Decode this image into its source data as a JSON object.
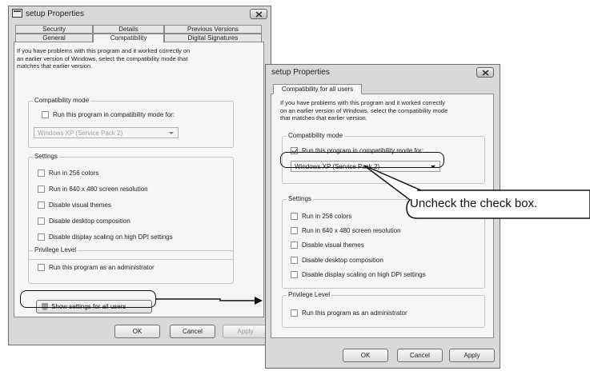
{
  "left_window": {
    "title": "setup Properties",
    "tabs_row1": [
      "Security",
      "Details",
      "Previous Versions"
    ],
    "tabs_row2": [
      "General",
      "Compatibility",
      "Digital Signatures"
    ],
    "description": [
      "If you have problems with this program and it worked correctly on",
      "an earlier version of Windows, select the compatibility mode that",
      "matches that earlier version."
    ],
    "compat_group": {
      "title": "Compatibility mode",
      "checkbox": "Run this program in compatibility mode for:",
      "select_value": "Windows XP (Service Pack 2)"
    },
    "settings_group": {
      "title": "Settings",
      "items": [
        "Run in 256 colors",
        "Run in 640 x 480 screen resolution",
        "Disable visual themes",
        "Disable desktop composition",
        "Disable display scaling on high DPI settings"
      ]
    },
    "privilege_group": {
      "title": "Privilege Level",
      "checkbox": "Run this program as an administrator"
    },
    "show_settings_button": "Show settings for all users",
    "buttons": {
      "ok": "OK",
      "cancel": "Cancel",
      "apply": "Apply"
    }
  },
  "right_window": {
    "title": "setup Properties",
    "tab": "Compatibility for all users",
    "description": [
      "If you have problems with this program and it worked correctly",
      "on an earlier version of Windows, select the compatibility mode",
      "that matches that earlier version."
    ],
    "compat_group": {
      "title": "Compatibility mode",
      "checkbox": "Run this program in compatibility mode for:",
      "checkbox_checked": true,
      "select_value": "Windows XP (Service Pack 2)"
    },
    "settings_group": {
      "title": "Settings",
      "items": [
        "Run in 256 colors",
        "Run in 640 x 480 screen resolution",
        "Disable visual themes",
        "Disable desktop composition",
        "Disable display scaling on high DPI settings"
      ]
    },
    "privilege_group": {
      "title": "Privilege Level",
      "checkbox": "Run this program as an administrator"
    },
    "buttons": {
      "ok": "OK",
      "cancel": "Cancel",
      "apply": "Apply"
    }
  },
  "callout_text": "Uncheck the check box."
}
